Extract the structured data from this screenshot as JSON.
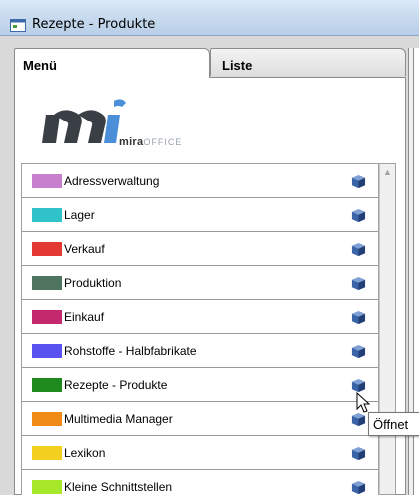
{
  "window": {
    "title": "Rezepte - Produkte"
  },
  "tabs": [
    {
      "label": "Menü",
      "active": true
    },
    {
      "label": "Liste",
      "active": false
    }
  ],
  "logo": {
    "word_main": "mira",
    "word_accent": "OFFICE"
  },
  "menu_items": [
    {
      "label": "Adressverwaltung",
      "color": "#c77fce"
    },
    {
      "label": "Lager",
      "color": "#2fc3c9"
    },
    {
      "label": "Verkauf",
      "color": "#e23a32"
    },
    {
      "label": "Produktion",
      "color": "#4f7460"
    },
    {
      "label": "Einkauf",
      "color": "#c4286d"
    },
    {
      "label": "Rohstoffe - Halbfabrikate",
      "color": "#5a52f0"
    },
    {
      "label": "Rezepte - Produkte",
      "color": "#1f8b1f"
    },
    {
      "label": "Multimedia Manager",
      "color": "#ef8b16"
    },
    {
      "label": "Lexikon",
      "color": "#f3cf20"
    },
    {
      "label": "Kleine Schnittstellen",
      "color": "#a8e82a"
    }
  ],
  "action_icon": "open-cube-icon",
  "tooltip": {
    "text": "Öffnet"
  },
  "colors": {
    "cube": "#3a63a8",
    "titlebar": "#c9dbef"
  }
}
